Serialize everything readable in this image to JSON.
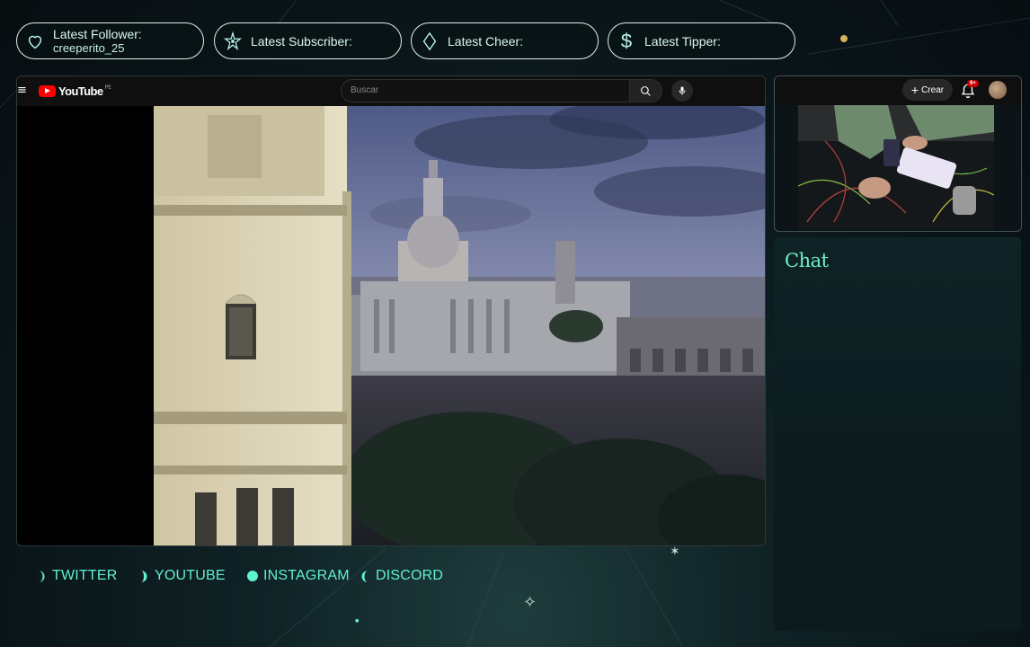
{
  "alerts": [
    {
      "label": "Latest Follower:",
      "value": "creeperito_25",
      "icon": "heart-icon"
    },
    {
      "label": "Latest Subscriber:",
      "value": "",
      "icon": "star-icon"
    },
    {
      "label": "Latest Cheer:",
      "value": "",
      "icon": "diamond-icon"
    },
    {
      "label": "Latest Tipper:",
      "value": "",
      "icon": "dollar-icon"
    }
  ],
  "youtube": {
    "menu_icon": "≡",
    "logo_text": "YouTube",
    "country_code": "PE",
    "search_placeholder": "Buscar"
  },
  "cam": {
    "create_label": "Crear",
    "notifications_badge": "9+"
  },
  "chat": {
    "title": "Chat"
  },
  "social_links": [
    {
      "label": "TWITTER",
      "icon": "moon-icon"
    },
    {
      "label": "YOUTUBE",
      "icon": "moon-icon"
    },
    {
      "label": "INSTAGRAM",
      "icon": "circle-icon"
    },
    {
      "label": "DISCORD",
      "icon": "crescent-icon"
    }
  ],
  "colors": {
    "accent": "#5ff0d0",
    "youtube_red": "#ff0000",
    "gold_dot": "#d8b35a"
  }
}
